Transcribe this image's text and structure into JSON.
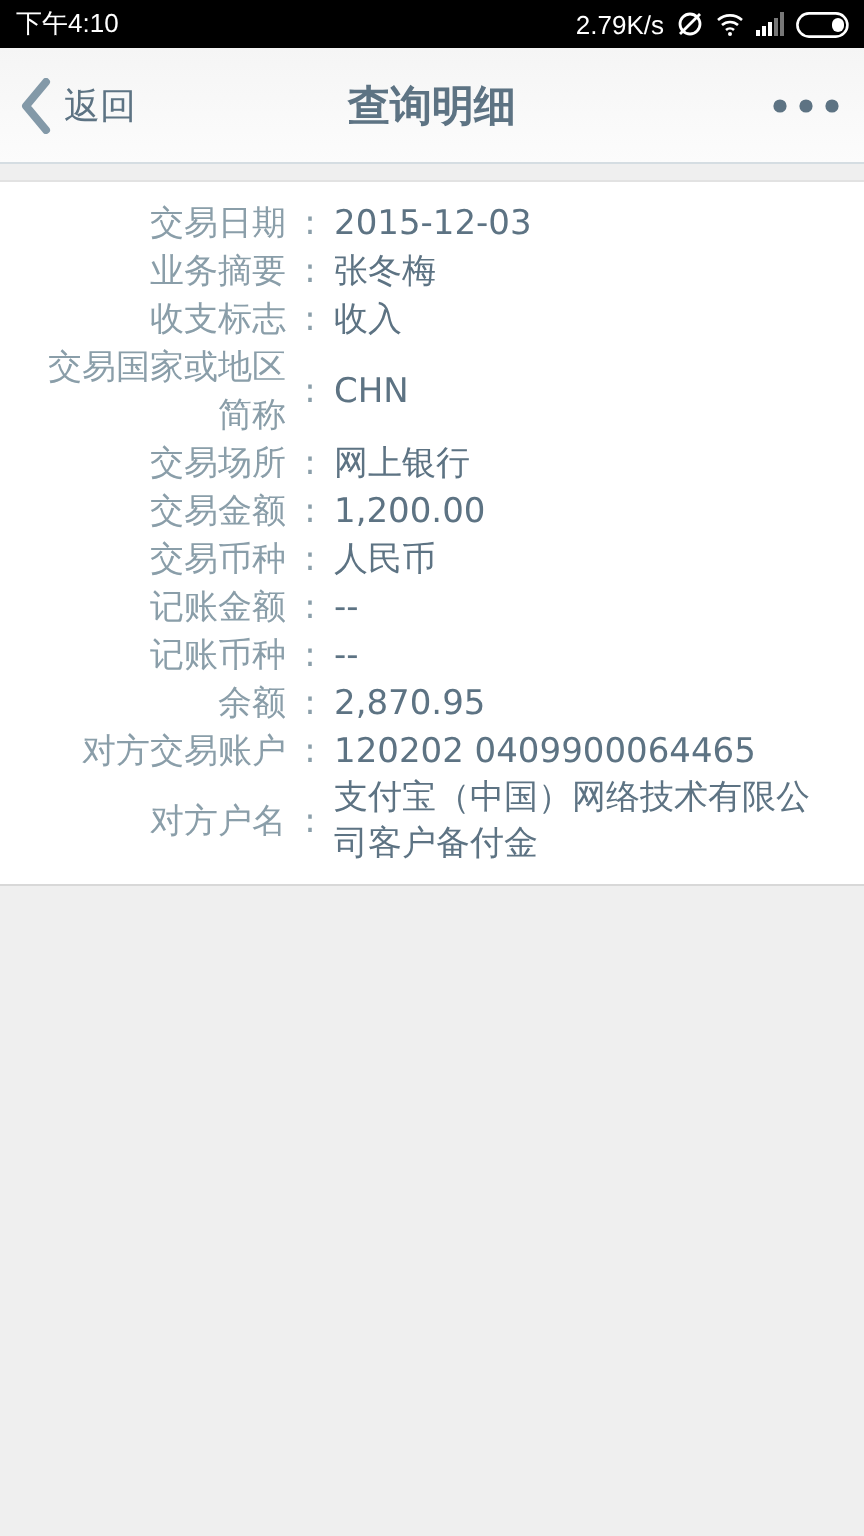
{
  "status_bar": {
    "time": "下午4:10",
    "speed": "2.79K/s"
  },
  "header": {
    "back": "返回",
    "title": "查询明细"
  },
  "details": [
    {
      "label": "交易日期",
      "separator": ":",
      "value": "2015-12-03"
    },
    {
      "label": "业务摘要",
      "separator": ":",
      "value": "张冬梅"
    },
    {
      "label": "收支标志",
      "separator": ":",
      "value": "收入"
    },
    {
      "label": "交易国家或地区简称",
      "separator": ":",
      "value": "CHN"
    },
    {
      "label": "交易场所",
      "separator": ":",
      "value": "网上银行"
    },
    {
      "label": "交易金额",
      "separator": ":",
      "value": "1,200.00"
    },
    {
      "label": "交易币种",
      "separator": ":",
      "value": "人民币"
    },
    {
      "label": "记账金额",
      "separator": ":",
      "value": "--"
    },
    {
      "label": "记账币种",
      "separator": ":",
      "value": "--"
    },
    {
      "label": "余额",
      "separator": ":",
      "value": "2,870.95"
    },
    {
      "label": "对方交易账户",
      "separator": ":",
      "value": "120202 0409900064465"
    },
    {
      "label": "对方户名",
      "separator": ":",
      "value": "支付宝（中国）网络技术有限公司客户备付金"
    }
  ]
}
